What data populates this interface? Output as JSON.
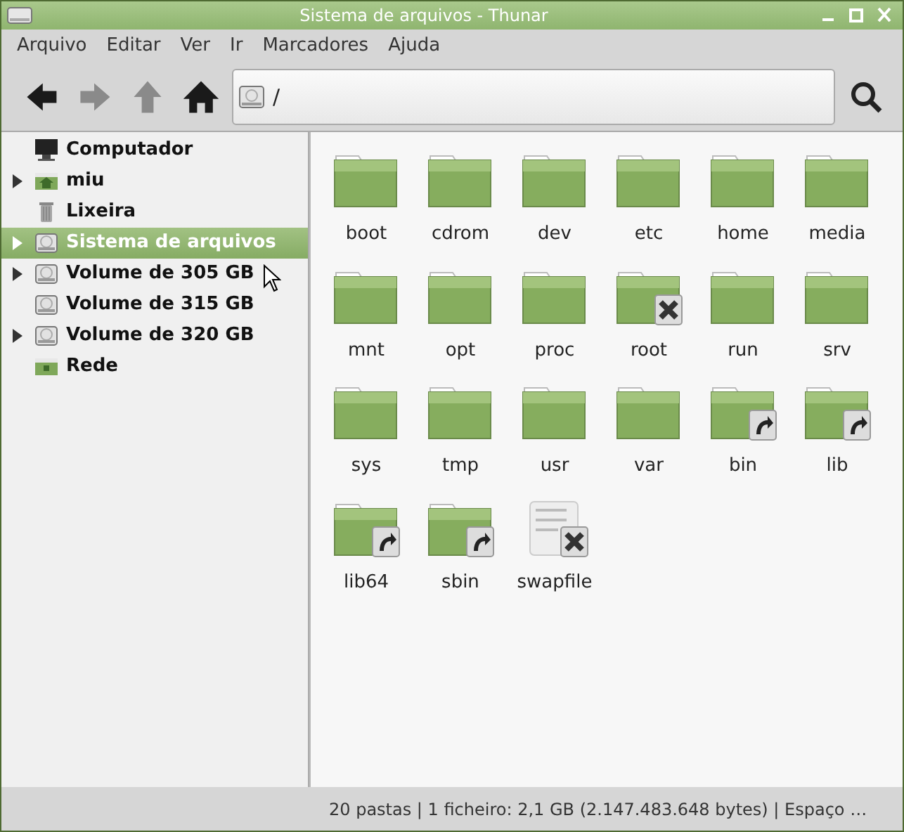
{
  "window": {
    "title": "Sistema de arquivos - Thunar"
  },
  "menu": [
    "Arquivo",
    "Editar",
    "Ver",
    "Ir",
    "Marcadores",
    "Ajuda"
  ],
  "toolbar": [
    {
      "kind": "back",
      "disabled": false
    },
    {
      "kind": "forward",
      "disabled": true
    },
    {
      "kind": "up",
      "disabled": true
    },
    {
      "kind": "home",
      "disabled": false
    }
  ],
  "location": {
    "value": "/"
  },
  "sidebar": {
    "items": [
      {
        "label": "Computador",
        "kind": "computer",
        "expandable": false,
        "selected": false
      },
      {
        "label": "miu",
        "kind": "home",
        "expandable": true,
        "selected": false
      },
      {
        "label": "Lixeira",
        "kind": "trash",
        "expandable": false,
        "selected": false
      },
      {
        "label": "Sistema de arquivos",
        "kind": "drive",
        "expandable": true,
        "selected": true
      },
      {
        "label": "Volume de 305 GB",
        "kind": "drive",
        "expandable": true,
        "selected": false
      },
      {
        "label": "Volume de 315 GB",
        "kind": "drive",
        "expandable": false,
        "selected": false
      },
      {
        "label": "Volume de 320 GB",
        "kind": "drive",
        "expandable": true,
        "selected": false
      },
      {
        "label": "Rede",
        "kind": "network",
        "expandable": false,
        "selected": false
      }
    ]
  },
  "files": [
    {
      "name": "boot",
      "kind": "folder"
    },
    {
      "name": "cdrom",
      "kind": "folder"
    },
    {
      "name": "dev",
      "kind": "folder"
    },
    {
      "name": "etc",
      "kind": "folder"
    },
    {
      "name": "home",
      "kind": "folder"
    },
    {
      "name": "media",
      "kind": "folder"
    },
    {
      "name": "mnt",
      "kind": "folder"
    },
    {
      "name": "opt",
      "kind": "folder"
    },
    {
      "name": "proc",
      "kind": "folder"
    },
    {
      "name": "root",
      "kind": "locked"
    },
    {
      "name": "run",
      "kind": "folder"
    },
    {
      "name": "srv",
      "kind": "folder"
    },
    {
      "name": "sys",
      "kind": "folder"
    },
    {
      "name": "tmp",
      "kind": "folder"
    },
    {
      "name": "usr",
      "kind": "folder"
    },
    {
      "name": "var",
      "kind": "folder"
    },
    {
      "name": "bin",
      "kind": "shortcut"
    },
    {
      "name": "lib",
      "kind": "shortcut"
    },
    {
      "name": "lib64",
      "kind": "shortcut"
    },
    {
      "name": "sbin",
      "kind": "shortcut"
    },
    {
      "name": "swapfile",
      "kind": "file"
    }
  ],
  "status_bar": "20 pastas | 1 ficheiro: 2,1 GB (2.147.483.648 bytes) | Espaço …"
}
